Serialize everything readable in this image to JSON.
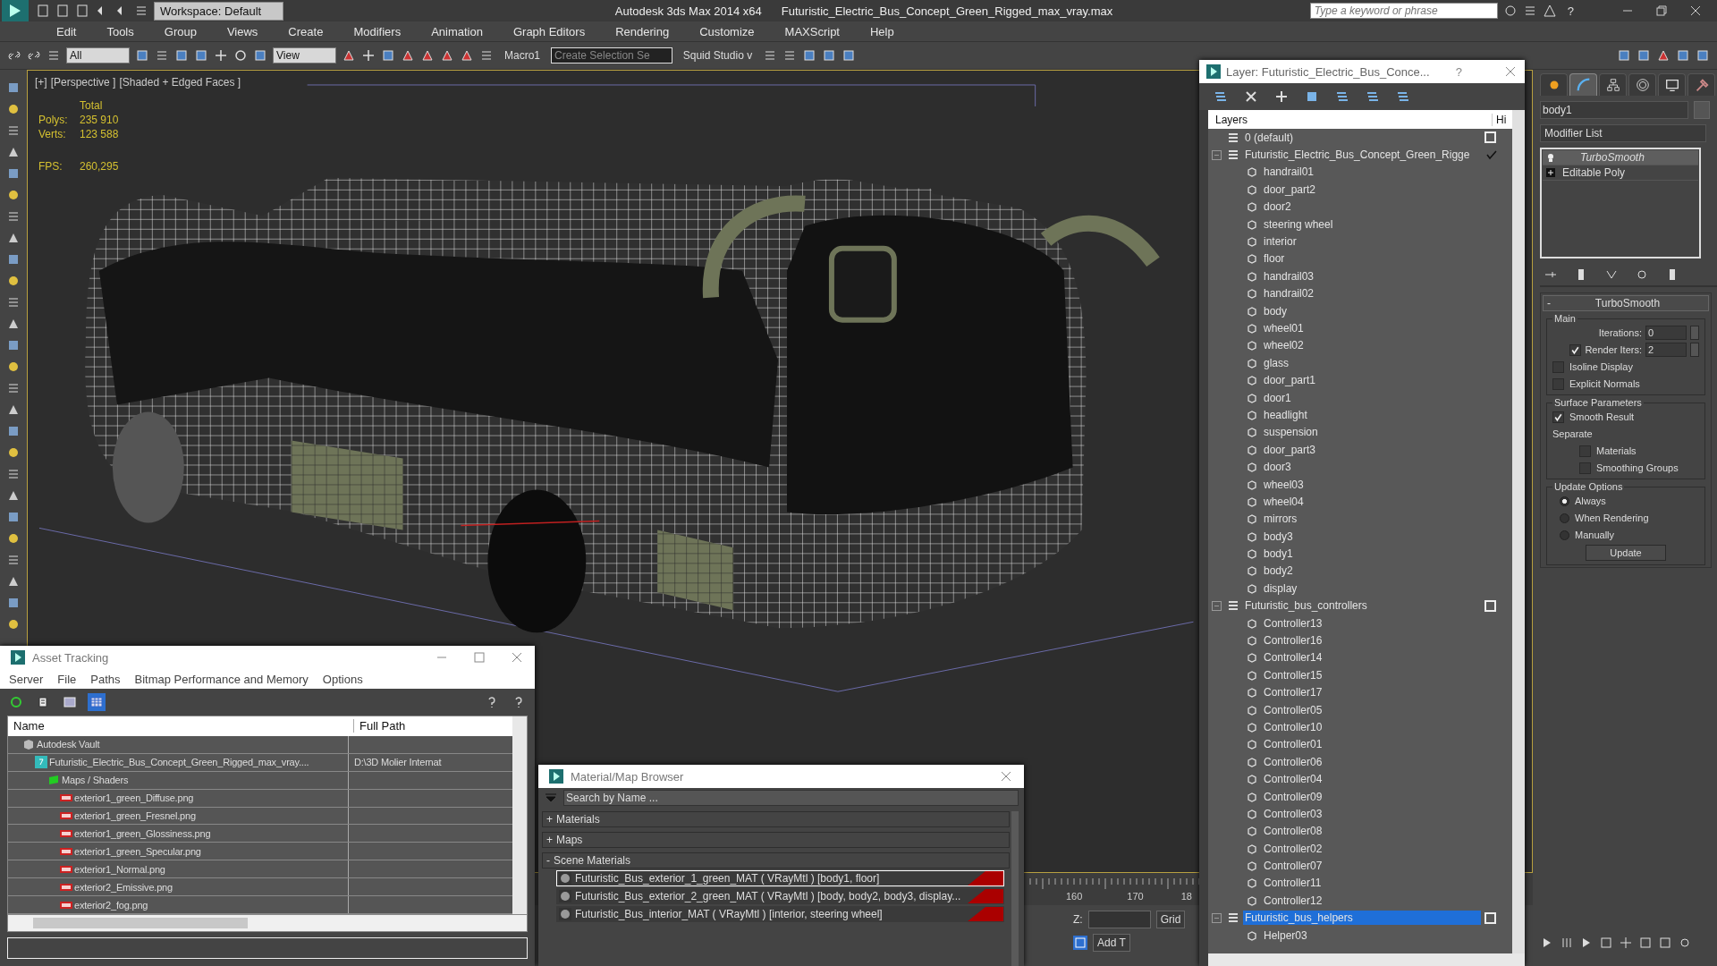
{
  "title_bar": {
    "workspace": "Workspace: Default",
    "app": "Autodesk 3ds Max  2014 x64",
    "file": "Futuristic_Electric_Bus_Concept_Green_Rigged_max_vray.max",
    "search": {
      "placeholder": "Type a keyword or phrase"
    },
    "help": "?"
  },
  "menu": [
    "Edit",
    "Tools",
    "Group",
    "Views",
    "Create",
    "Modifiers",
    "Animation",
    "Graph Editors",
    "Rendering",
    "Customize",
    "MAXScript",
    "Help"
  ],
  "toolbar": {
    "selection_filter": "All",
    "coordinate_system": "View",
    "macro": "Macro1",
    "selection_set": "Create Selection Se",
    "plugin": "Squid Studio v"
  },
  "viewport": {
    "labels": [
      "[+]",
      "[Perspective ]",
      "[Shaded + Edged Faces ]"
    ],
    "stats": {
      "header": "Total",
      "rows": [
        {
          "label": "Polys:",
          "value": "235 910"
        },
        {
          "label": "Verts:",
          "value": "123 588"
        }
      ]
    },
    "fps": {
      "label": "FPS:",
      "value": "260,295"
    }
  },
  "timeline": {
    "ticks": [
      "160",
      "170",
      "18"
    ]
  },
  "status_bar": {
    "z_label": "Z:",
    "grid": "Grid",
    "add_button": "Add T"
  },
  "layer_window": {
    "title": "Layer: Futuristic_Electric_Bus_Conce...",
    "help": "?",
    "columns": [
      "Layers",
      "Hi"
    ],
    "layers": [
      {
        "name": "0 (default)",
        "current": false,
        "selected": false
      },
      {
        "name": "Futuristic_Electric_Bus_Concept_Green_Rigge",
        "current": true,
        "selected": false,
        "children": [
          {
            "name": "handrail01"
          },
          {
            "name": "door_part2"
          },
          {
            "name": "door2"
          },
          {
            "name": "steering wheel"
          },
          {
            "name": "interior"
          },
          {
            "name": "floor"
          },
          {
            "name": "handrail03"
          },
          {
            "name": "handrail02"
          },
          {
            "name": "body"
          },
          {
            "name": "wheel01"
          },
          {
            "name": "wheel02"
          },
          {
            "name": "glass"
          },
          {
            "name": "door_part1"
          },
          {
            "name": "door1"
          },
          {
            "name": "headlight"
          },
          {
            "name": "suspension"
          },
          {
            "name": "door_part3"
          },
          {
            "name": "door3"
          },
          {
            "name": "wheel03"
          },
          {
            "name": "wheel04"
          },
          {
            "name": "mirrors"
          },
          {
            "name": "body3"
          },
          {
            "name": "body1"
          },
          {
            "name": "body2"
          },
          {
            "name": "display"
          }
        ]
      },
      {
        "name": "Futuristic_bus_controllers",
        "current": false,
        "selected": false,
        "children": [
          {
            "name": "Controller13"
          },
          {
            "name": "Controller16"
          },
          {
            "name": "Controller14"
          },
          {
            "name": "Controller15"
          },
          {
            "name": "Controller17"
          },
          {
            "name": "Controller05"
          },
          {
            "name": "Controller10"
          },
          {
            "name": "Controller01"
          },
          {
            "name": "Controller06"
          },
          {
            "name": "Controller04"
          },
          {
            "name": "Controller09"
          },
          {
            "name": "Controller03"
          },
          {
            "name": "Controller08"
          },
          {
            "name": "Controller02"
          },
          {
            "name": "Controller07"
          },
          {
            "name": "Controller11"
          },
          {
            "name": "Controller12"
          }
        ]
      },
      {
        "name": "Futuristic_bus_helpers",
        "current": false,
        "selected": true,
        "children": [
          {
            "name": "Helper03"
          }
        ]
      }
    ]
  },
  "command_panel": {
    "tabs": [
      {
        "kind": "create",
        "selected": false
      },
      {
        "kind": "modify",
        "selected": true
      },
      {
        "kind": "hierarchy",
        "selected": false
      },
      {
        "kind": "motion",
        "selected": false
      },
      {
        "kind": "display",
        "selected": false
      },
      {
        "kind": "utilities",
        "selected": false
      }
    ],
    "object_name": "body1",
    "modifier_list": "Modifier List",
    "stack": [
      {
        "name": "TurboSmooth",
        "kind": "modifier",
        "selected": true
      },
      {
        "name": "Editable Poly",
        "kind": "base_object",
        "selected": false
      }
    ],
    "rollout": {
      "collapse_sign": "-",
      "title": "TurboSmooth",
      "main": {
        "legend": "Main",
        "iterations": {
          "label": "Iterations:",
          "value": "0"
        },
        "render_iters": {
          "label": "Render Iters:",
          "value": "2",
          "checked": true
        },
        "isoline_display": {
          "label": "Isoline Display",
          "checked": false
        },
        "explicit_normals": {
          "label": "Explicit Normals",
          "checked": false
        }
      },
      "surface": {
        "legend": "Surface Parameters",
        "smooth_result": {
          "label": "Smooth Result",
          "checked": true
        },
        "separate": "Separate",
        "materials": {
          "label": "Materials",
          "checked": false
        },
        "smoothing_groups": {
          "label": "Smoothing Groups",
          "checked": false
        }
      },
      "update": {
        "legend": "Update Options",
        "options": [
          {
            "label": "Always",
            "selected": true
          },
          {
            "label": "When Rendering",
            "selected": false
          },
          {
            "label": "Manually",
            "selected": false
          }
        ],
        "button": "Update"
      }
    }
  },
  "asset_tracking": {
    "title": "Asset Tracking",
    "menu": [
      "Server",
      "File",
      "Paths",
      "Bitmap Performance and Memory",
      "Options"
    ],
    "columns": [
      "Name",
      "Full Path"
    ],
    "rows": [
      {
        "kind": "vault",
        "name": "Autodesk Vault",
        "children": [
          {
            "kind": "max_file",
            "name": "Futuristic_Electric_Bus_Concept_Green_Rigged_max_vray....",
            "path": "D:\\3D Molier Internat",
            "children": [
              {
                "kind": "folder",
                "name": "Maps / Shaders",
                "children": [
                  {
                    "kind": "png",
                    "name": "exterior1_green_Diffuse.png"
                  },
                  {
                    "kind": "png",
                    "name": "exterior1_green_Fresnel.png"
                  },
                  {
                    "kind": "png",
                    "name": "exterior1_green_Glossiness.png"
                  },
                  {
                    "kind": "png",
                    "name": "exterior1_green_Specular.png"
                  },
                  {
                    "kind": "png",
                    "name": "exterior1_Normal.png"
                  },
                  {
                    "kind": "png",
                    "name": "exterior2_Emissive.png"
                  },
                  {
                    "kind": "png",
                    "name": "exterior2_fog.png"
                  }
                ]
              }
            ]
          }
        ]
      }
    ]
  },
  "material_browser": {
    "title": "Material/Map Browser",
    "search": {
      "placeholder": "Search by Name ..."
    },
    "groups": [
      {
        "sign": "+",
        "label": "Materials"
      },
      {
        "sign": "+",
        "label": "Maps"
      },
      {
        "sign": "-",
        "label": "Scene Materials",
        "items": [
          {
            "name": "Futuristic_Bus_exterior_1_green_MAT  ( VRayMtl )  [body1, floor]",
            "selected": true
          },
          {
            "name": "Futuristic_Bus_exterior_2_green_MAT  ( VRayMtl )  [body, body2, body3, display...",
            "selected": false
          },
          {
            "name": "Futuristic_Bus_interior_MAT  ( VRayMtl )  [interior, steering wheel]",
            "selected": false
          }
        ]
      }
    ]
  }
}
